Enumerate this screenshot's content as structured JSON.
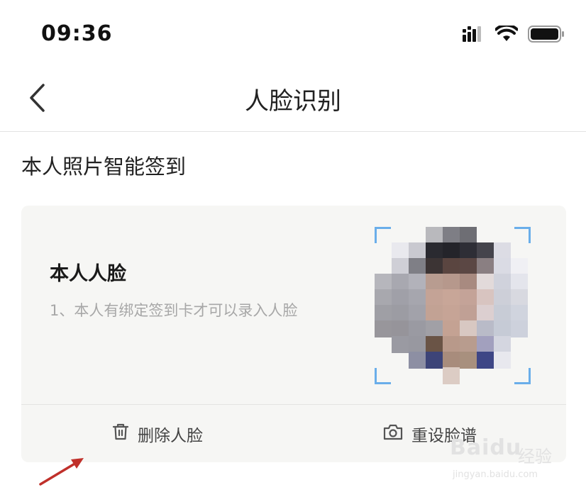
{
  "status_bar": {
    "time": "09:36",
    "icons": [
      "signal-icon",
      "wifi-icon",
      "battery-icon"
    ]
  },
  "nav": {
    "back_icon": "chevron-left-icon",
    "title": "人脸识别"
  },
  "section": {
    "title": "本人照片智能签到"
  },
  "card": {
    "heading": "本人人脸",
    "description": "1、本人有绑定签到卡才可以录入人脸",
    "photo": "pixelated-face-photo",
    "actions": [
      {
        "label": "删除人脸",
        "icon": "trash-icon"
      },
      {
        "label": "重设脸谱",
        "icon": "camera-icon"
      }
    ]
  },
  "annotation": {
    "arrow_color": "#c0302a"
  },
  "watermark": {
    "brand": "Baidu",
    "brand_cn": "经验",
    "url": "jingyan.baidu.com"
  },
  "colors": {
    "accent_corner": "#6aaeea",
    "card_bg": "#f6f6f4",
    "muted_text": "#a7a7a7"
  }
}
